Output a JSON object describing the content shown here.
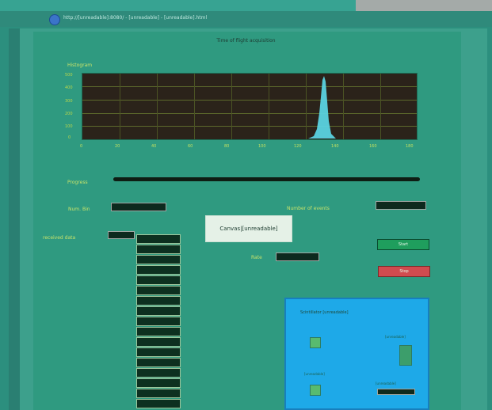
{
  "window": {
    "url": "http://[unreadable]:8080/ - [unreadable] - [unreadable].html"
  },
  "panel": {
    "title": "Time of flight acquisition"
  },
  "histogram": {
    "label": "Histogram",
    "y_ticks": [
      "500",
      "400",
      "300",
      "200",
      "100",
      "0"
    ],
    "x_ticks": [
      "0",
      "20",
      "40",
      "60",
      "80",
      "100",
      "120",
      "140",
      "160",
      "180"
    ]
  },
  "controls": {
    "progress_label": "Progress",
    "progress_value": 0.99,
    "num_bin_label": "Num. Bin",
    "num_bin_value": "",
    "number_of_events_label": "Number of events",
    "number_of_events_value": "",
    "status_text": "Canvas|[unreadable]",
    "received_data_label": "received data",
    "received_data_value": "",
    "rate_label": "Rate",
    "rate_value": "",
    "start_label": "Start",
    "stop_label": "Stop"
  },
  "received_data": {
    "values": [
      "",
      "",
      "",
      "",
      "",
      "",
      "",
      "",
      "",
      "",
      "",
      "",
      "",
      "",
      "",
      "",
      ""
    ]
  },
  "subpanel": {
    "title": "Scintillator [unreadable]",
    "label_right": "[unreadable]",
    "label_left_lower": "[unreadable]",
    "label_bottom_right": "[unreadable]"
  },
  "colors": {
    "background": "#2c8f7e",
    "panel": "#2f9a80",
    "chart_bg": "#2b231a",
    "plot_peak": "#5ad3e0",
    "start_button": "#1f9e5d",
    "stop_button": "#d04b4f",
    "subpanel_bg": "#1ea9e8"
  },
  "icons": [
    "globe-icon",
    "led-icon"
  ]
}
